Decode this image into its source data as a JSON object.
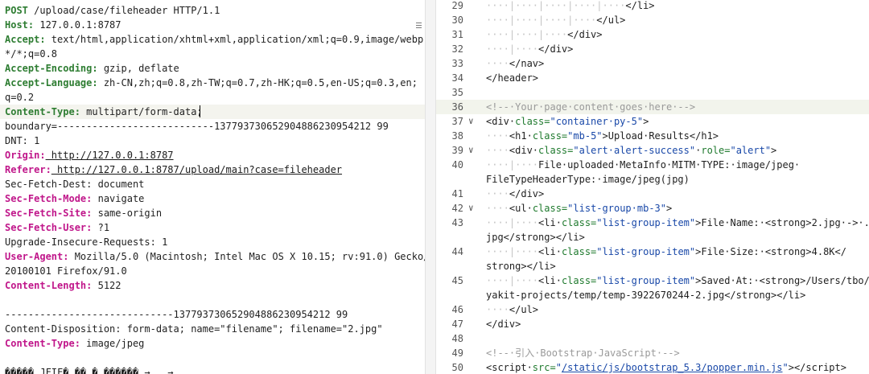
{
  "request": {
    "lines": [
      {
        "key": "POST",
        "val": " /upload/case/fileheader HTTP/1.1",
        "keycolor": "#2e7d32"
      },
      {
        "key": "Host:",
        "val": " 127.0.0.1:8787",
        "keycolor": "#2e7d32"
      },
      {
        "key": "Accept:",
        "val": " text/html,application/xhtml+xml,application/xml;q=0.9,image/webp,",
        "keycolor": "#2e7d32"
      },
      {
        "key": "",
        "val": "*/*;q=0.8"
      },
      {
        "key": "Accept-Encoding:",
        "val": " gzip, deflate",
        "keycolor": "#2e7d32"
      },
      {
        "key": "Accept-Language:",
        "val": " zh-CN,zh;q=0.8,zh-TW;q=0.7,zh-HK;q=0.5,en-US;q=0.3,en;",
        "keycolor": "#2e7d32"
      },
      {
        "key": "",
        "val": "q=0.2"
      },
      {
        "key": "Content-Type:",
        "val": " multipart/form-data;",
        "keycolor": "#2e7d32",
        "highlight": true
      },
      {
        "key": "",
        "val": "boundary=---------------------------137793730652904886230954212 99"
      },
      {
        "key": "",
        "val": "DNT: 1"
      },
      {
        "key": "Origin:",
        "val": " http://127.0.0.1:8787",
        "keycolor": "#c0168a",
        "underline": true
      },
      {
        "key": "Referer:",
        "val": " http://127.0.0.1:8787/upload/main?case=fileheader",
        "keycolor": "#c0168a",
        "underline": true
      },
      {
        "key": "",
        "val": "Sec-Fetch-Dest: document"
      },
      {
        "key": "Sec-Fetch-Mode:",
        "val": " navigate",
        "keycolor": "#c0168a"
      },
      {
        "key": "Sec-Fetch-Site:",
        "val": " same-origin",
        "keycolor": "#c0168a"
      },
      {
        "key": "Sec-Fetch-User:",
        "val": " ?1",
        "keycolor": "#c0168a"
      },
      {
        "key": "",
        "val": "Upgrade-Insecure-Requests: 1"
      },
      {
        "key": "User-Agent:",
        "val": " Mozilla/5.0 (Macintosh; Intel Mac OS X 10.15; rv:91.0) Gecko/",
        "keycolor": "#c0168a"
      },
      {
        "key": "",
        "val": "20100101 Firefox/91.0"
      },
      {
        "key": "Content-Length:",
        "val": " 5122",
        "keycolor": "#c0168a"
      },
      {
        "key": "",
        "val": ""
      },
      {
        "key": "",
        "val": "-----------------------------137793730652904886230954212 99"
      },
      {
        "key": "",
        "val": "Content-Disposition: form-data; name=\"filename\"; filename=\"2.jpg\""
      },
      {
        "key": "Content-Type:",
        "val": " image/jpeg",
        "keycolor": "#c0168a"
      },
      {
        "key": "",
        "val": ""
      },
      {
        "key": "",
        "val": "����� JFIF� �� � ������ →   →"
      }
    ]
  },
  "response": {
    "lines": [
      {
        "n": "29",
        "html": "<span class=\"guide\">····|····|····|····|····</span>&lt;/li&gt;"
      },
      {
        "n": "30",
        "html": "<span class=\"guide\">····|····|····|····</span>&lt;/ul&gt;"
      },
      {
        "n": "31",
        "html": "<span class=\"guide\">····|····|····</span>&lt;/div&gt;"
      },
      {
        "n": "32",
        "html": "<span class=\"guide\">····|····</span>&lt;/div&gt;"
      },
      {
        "n": "33",
        "html": "<span class=\"guide\">····</span>&lt;/nav&gt;"
      },
      {
        "n": "34",
        "html": "&lt;/header&gt;"
      },
      {
        "n": "35",
        "html": ""
      },
      {
        "n": "36",
        "html": "<span class=\"cmt\">&lt;!--·Your·page·content·goes·here·--&gt;</span>",
        "current": true
      },
      {
        "n": "37",
        "fold": "∨",
        "html": "&lt;div·<span class=\"attr\">class=</span><span class=\"str\">\"container·py-5\"</span>&gt;"
      },
      {
        "n": "38",
        "html": "<span class=\"guide\">····</span>&lt;h1·<span class=\"attr\">class=</span><span class=\"str\">\"mb-5\"</span>&gt;Upload·Results&lt;/h1&gt;"
      },
      {
        "n": "39",
        "fold": "∨",
        "html": "<span class=\"guide\">····</span>&lt;div·<span class=\"attr\">class=</span><span class=\"str\">\"alert·alert-success\"</span>·<span class=\"attr\">role=</span><span class=\"str\">\"alert\"</span>&gt;"
      },
      {
        "n": "40",
        "html": "<span class=\"guide\">····|····</span>File·uploaded·MetaInfo·MITM·TYPE:·image/jpeg·"
      },
      {
        "n": "",
        "html": "FileTypeHeaderType:·image/jpeg(jpg)",
        "wrap": true
      },
      {
        "n": "41",
        "html": "<span class=\"guide\">····</span>&lt;/div&gt;"
      },
      {
        "n": "42",
        "fold": "∨",
        "html": "<span class=\"guide\">····</span>&lt;ul·<span class=\"attr\">class=</span><span class=\"str\">\"list-group·mb-3\"</span>&gt;"
      },
      {
        "n": "43",
        "html": "<span class=\"guide\">····|····</span>&lt;li·<span class=\"attr\">class=</span><span class=\"str\">\"list-group-item\"</span>&gt;File·Name:·&lt;strong&gt;2.jpg·-&gt;·."
      },
      {
        "n": "",
        "html": "jpg&lt;/strong&gt;&lt;/li&gt;",
        "wrap": true
      },
      {
        "n": "44",
        "html": "<span class=\"guide\">····|····</span>&lt;li·<span class=\"attr\">class=</span><span class=\"str\">\"list-group-item\"</span>&gt;File·Size:·&lt;strong&gt;4.8K&lt;/"
      },
      {
        "n": "",
        "html": "strong&gt;&lt;/li&gt;",
        "wrap": true
      },
      {
        "n": "45",
        "html": "<span class=\"guide\">····|····</span>&lt;li·<span class=\"attr\">class=</span><span class=\"str\">\"list-group-item\"</span>&gt;Saved·At:·&lt;strong&gt;/Users/tbo/"
      },
      {
        "n": "",
        "html": "yakit-projects/temp/temp-3922670244-2.jpg&lt;/strong&gt;&lt;/li&gt;",
        "wrap": true
      },
      {
        "n": "46",
        "html": "<span class=\"guide\">····</span>&lt;/ul&gt;"
      },
      {
        "n": "47",
        "html": "&lt;/div&gt;"
      },
      {
        "n": "48",
        "html": ""
      },
      {
        "n": "49",
        "html": "<span class=\"cmt\">&lt;!--·引入·Bootstrap·JavaScript·--&gt;</span>"
      },
      {
        "n": "50",
        "html": "&lt;script·<span class=\"attr\">src=</span><span class=\"str\">\"<span class=\"lnk\">/static/js/bootstrap_5.3/popper.min.js</span>\"</span>&gt;&lt;/script&gt;"
      }
    ]
  }
}
